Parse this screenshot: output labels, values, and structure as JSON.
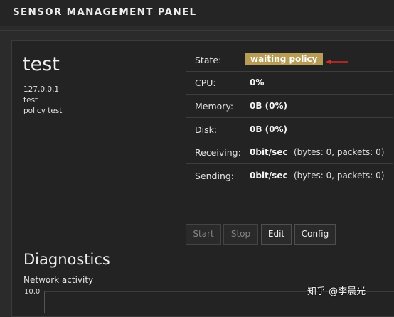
{
  "header": {
    "title": "SENSOR MANAGEMENT PANEL"
  },
  "sensor": {
    "name": "test",
    "ip": "127.0.0.1",
    "description": "test",
    "policy": "policy test"
  },
  "stats": {
    "state": {
      "label": "State:",
      "value": "waiting policy",
      "badge_color": "#b99c55"
    },
    "cpu": {
      "label": "CPU:",
      "value": "0%"
    },
    "memory": {
      "label": "Memory:",
      "value": "0B (0%)"
    },
    "disk": {
      "label": "Disk:",
      "value": "0B (0%)"
    },
    "receiving": {
      "label": "Receiving:",
      "value": "0bit/sec",
      "detail": "(bytes: 0, packets: 0)"
    },
    "sending": {
      "label": "Sending:",
      "value": "0bit/sec",
      "detail": "(bytes: 0, packets: 0)"
    }
  },
  "buttons": {
    "start": "Start",
    "stop": "Stop",
    "edit": "Edit",
    "config": "Config"
  },
  "diagnostics": {
    "title": "Diagnostics",
    "network_activity_label": "Network activity",
    "y_max_tick": "10.0"
  },
  "watermark": {
    "text": "知乎 @李晨光"
  },
  "colors": {
    "annotation_arrow": "#d42a2a"
  }
}
